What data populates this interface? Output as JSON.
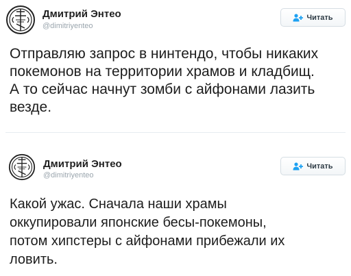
{
  "tweets": [
    {
      "author_name": "Дмитрий Энтео",
      "author_handle": "@dimitriyenteo",
      "follow_label": "Читать",
      "avatar_icon": "orthodox-seal-icon",
      "follow_icon": "add-user-icon",
      "text": "Отправляю запрос в нинтендо, чтобы никаких\nпокемонов на территории храмов и кладбищ.\nА то сейчас начнут зомби с айфонами лазить\nвезде."
    },
    {
      "author_name": "Дмитрий Энтео",
      "author_handle": "@dimitriyenteo",
      "follow_label": "Читать",
      "avatar_icon": "orthodox-seal-icon",
      "follow_icon": "add-user-icon",
      "text": "Какой ужас. Сначала наши храмы\nоккупировали японские бесы-покемоны,\nпотом хипстеры с айфонами прибежали их\nловить."
    }
  ],
  "colors": {
    "follow_icon_blue": "#1da1f2",
    "handle_gray": "#9aa5ad",
    "divider": "#e6ecf0"
  }
}
